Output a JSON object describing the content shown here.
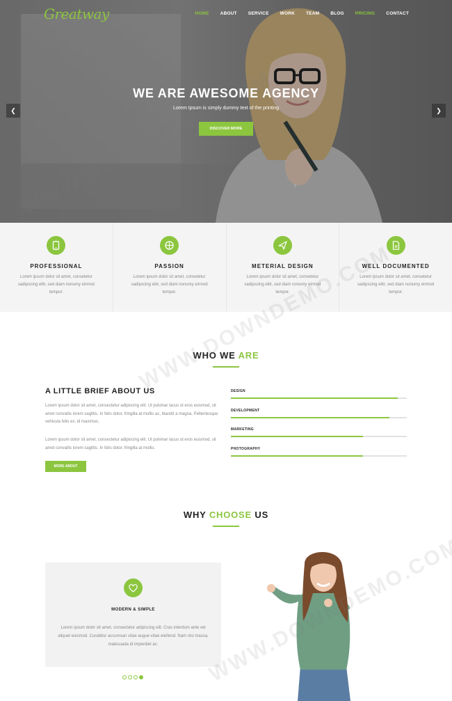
{
  "brand": {
    "logo": "Greatway",
    "accent": "#8cc63f"
  },
  "nav": {
    "items": [
      "HOME",
      "ABOUT",
      "SERVICE",
      "WORK",
      "TEAM",
      "BLOG",
      "PRICING",
      "CONTACT"
    ],
    "active": [
      "HOME",
      "PRICING"
    ]
  },
  "hero": {
    "title": "WE ARE AWESOME AGENCY",
    "subtitle": "Lorem Ipsum is simply dummy text of the printing",
    "button": "DISCOVER MORE",
    "prev_icon": "chevron-left-icon",
    "next_icon": "chevron-right-icon"
  },
  "features": [
    {
      "icon": "phone-icon",
      "title": "PROFESSIONAL",
      "text": "Lorem ipsum dolor sit amet, consetetur sadipscing elitr, sed diam nonumy eirmod tempor."
    },
    {
      "icon": "globe-icon",
      "title": "PASSION",
      "text": "Lorem ipsum dolor sit amet, consetetur sadipscing elitr, sed diam nonumy eirmod tempor."
    },
    {
      "icon": "paper-plane-icon",
      "title": "METERIAL DESIGN",
      "text": "Lorem ipsum dolor sit amet, consetetur sadipscing elitr, sed diam nonumy eirmod tempor."
    },
    {
      "icon": "document-icon",
      "title": "WELL DOCUMENTED",
      "text": "Lorem ipsum dolor sit amet, consetetur sadipscing elitr, sed diam nonumy eirmod tempor."
    }
  ],
  "who": {
    "title_a": "WHO WE ",
    "title_b": "ARE",
    "brief_title": "A LITTLE BRIEF ABOUT US",
    "para1": "Lorem ipsum dolor sit amet, consectetur adipiscing elit. Ut pulvinar lacus ut eros euismod, sit amet convallis lorem sagittis. In felis dolor, fringilla at mollis ac, blandit a magna. Pellentesque vehicula felis ex, id maximus.",
    "para2": "Lorem ipsum dolor sit amet, consectetur adipiscing elit. Ut pulvinar lacus ut eros euismod, sit amet convallis lorem sagittis. In felis dolor, fringilla at mollis.",
    "button": "MORE ABOUT",
    "skills": [
      {
        "label": "DESIGN",
        "percent": 95
      },
      {
        "label": "DEVELOPMENT",
        "percent": 90
      },
      {
        "label": "MARKETING",
        "percent": 75
      },
      {
        "label": "PHOTOGRAPHY",
        "percent": 75
      }
    ]
  },
  "why": {
    "title_a": "WHY ",
    "title_b": "CHOOSE",
    "title_c": " US",
    "card_icon": "heart-icon",
    "card_title": "MODERN & SIMPLE",
    "card_text": "Lorem ipsum dolor sit amet, consectetur adipiscing elit. Cras interdum ante vel aliquet euismod. Curabitur accumsan vitae augue vitae eleifend. Nam nisi massa, malesuada id imperdiet ac.",
    "slider_count": 4,
    "slider_active": 4
  },
  "watermark": "WWW.DOWNDEMO.COM"
}
